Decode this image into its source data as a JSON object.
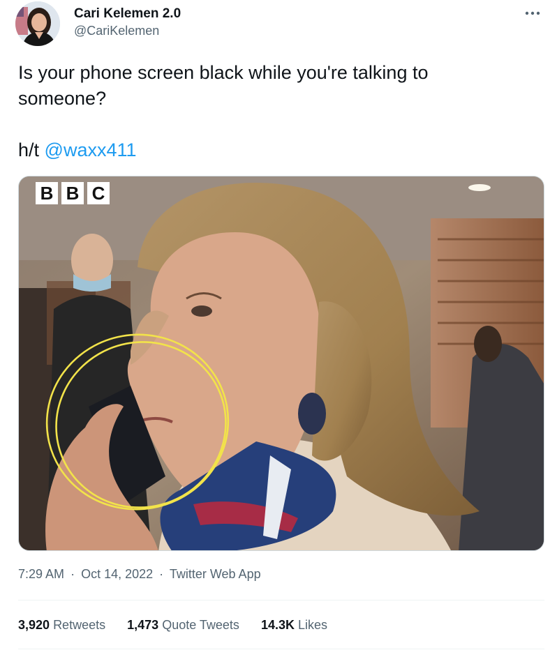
{
  "author": {
    "display_name": "Cari Kelemen 2.0",
    "handle": "@CariKelemen"
  },
  "tweet": {
    "text_line1": "Is your phone screen black while you're talking to",
    "text_line2": "someone?",
    "ht_prefix": "h/t ",
    "mention": "@waxx411",
    "media_watermark": "BBC"
  },
  "meta": {
    "time": "7:29 AM",
    "date": "Oct 14, 2022",
    "source": "Twitter Web App",
    "separator": "·"
  },
  "stats": {
    "retweets_count": "3,920",
    "retweets_label": "Retweets",
    "quotes_count": "1,473",
    "quotes_label": "Quote Tweets",
    "likes_count": "14.3K",
    "likes_label": "Likes"
  },
  "icons": {
    "more": "more-horizontal-icon"
  },
  "colors": {
    "link": "#1d9bf0",
    "secondary_text": "#536471",
    "highlight_circle": "#f2e34a"
  }
}
